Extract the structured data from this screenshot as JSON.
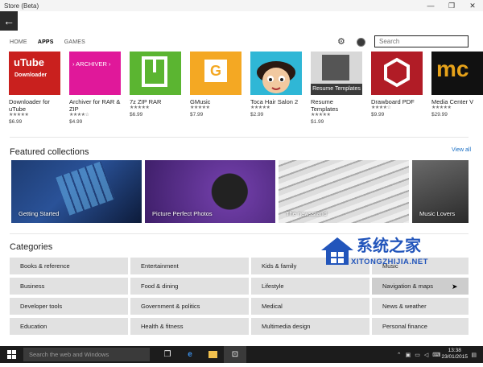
{
  "window": {
    "title": "Store (Beta)",
    "controls": [
      "—",
      "❐",
      "✕"
    ]
  },
  "nav": {
    "back_glyph": "←",
    "tabs": [
      {
        "label": "HOME"
      },
      {
        "label": "APPS"
      },
      {
        "label": "GAMES"
      }
    ],
    "active_tab": "APPS",
    "search_placeholder": "Search"
  },
  "apps": [
    {
      "name": "Downloader for uTube",
      "price": "$6.99",
      "stars": "★★★★★",
      "tile_text": "uTube Downloader",
      "tile_color": "#c9201e"
    },
    {
      "name": "Archiver for RAR & ZIP",
      "price": "$4.99",
      "stars": "★★★★☆",
      "tile_text": "ARCHIVER",
      "tile_color": "#e0189a"
    },
    {
      "name": "7z ZIP RAR",
      "price": "$6.99",
      "stars": "★★★★★",
      "tile_text": "",
      "tile_color": "#5bb531"
    },
    {
      "name": "GMusic",
      "price": "$7.99",
      "stars": "★★★★★",
      "tile_text": "G",
      "tile_color": "#f4a823"
    },
    {
      "name": "Toca Hair Salon 2",
      "price": "$2.99",
      "stars": "★★★★★",
      "tile_text": "",
      "tile_color": "#2fb7d6"
    },
    {
      "name": "Resume Templates",
      "price": "$1.99",
      "stars": "★★★★★",
      "tile_text": "Resume Templates",
      "tile_color": "#3b3b3b"
    },
    {
      "name": "Drawboard PDF",
      "price": "$9.99",
      "stars": "★★★★☆",
      "tile_text": "",
      "tile_color": "#b11c26"
    },
    {
      "name": "Media Center V",
      "price": "$29.99",
      "stars": "★★★★★",
      "tile_text": "mc",
      "tile_color": "#111111"
    }
  ],
  "featured": {
    "title": "Featured collections",
    "view_all": "View all",
    "items": [
      {
        "label": "Getting Started"
      },
      {
        "label": "Picture Perfect Photos"
      },
      {
        "label": "The newsstand"
      },
      {
        "label": "Music Lovers"
      }
    ]
  },
  "categories": {
    "title": "Categories",
    "items": [
      "Books & reference",
      "Entertainment",
      "Kids & family",
      "Music",
      "Business",
      "Food & dining",
      "Lifestyle",
      "Navigation & maps",
      "Developer tools",
      "Government & politics",
      "Medical",
      "News & weather",
      "Education",
      "Health & fitness",
      "Multimedia design",
      "Personal finance"
    ]
  },
  "watermark": {
    "cn": "系统之家",
    "en": "XITONGZHIJIA.NET"
  },
  "taskbar": {
    "search_placeholder": "Search the web and Windows",
    "time": "13:38",
    "date": "23/01/2015"
  },
  "colors": {
    "accent_link": "#1a6fc4",
    "category_bg": "#e1e1e1",
    "taskbar_bg": "#1c1c1c"
  }
}
